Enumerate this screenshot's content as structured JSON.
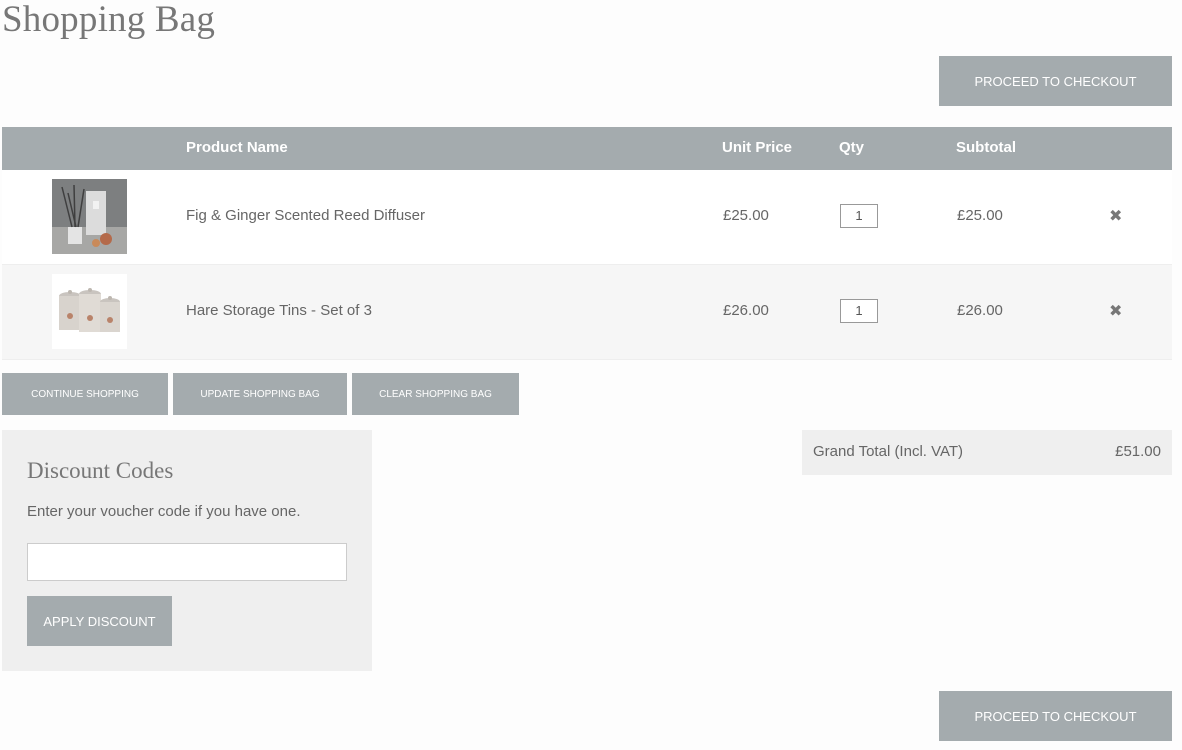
{
  "page": {
    "title": "Shopping Bag"
  },
  "checkout": {
    "label": "Proceed to Checkout"
  },
  "table": {
    "headers": {
      "product_name": "Product Name",
      "unit_price": "Unit Price",
      "qty": "Qty",
      "subtotal": "Subtotal"
    },
    "rows": [
      {
        "name": "Fig & Ginger Scented Reed Diffuser",
        "unit_price": "£25.00",
        "qty": "1",
        "subtotal": "£25.00",
        "thumb_icon": "reed-diffuser-image",
        "remove_icon": "close-icon"
      },
      {
        "name": "Hare Storage Tins - Set of 3",
        "unit_price": "£26.00",
        "qty": "1",
        "subtotal": "£26.00",
        "thumb_icon": "storage-tins-image",
        "remove_icon": "close-icon"
      }
    ]
  },
  "actions": {
    "continue": "Continue Shopping",
    "update": "Update Shopping Bag",
    "clear": "Clear Shopping Bag"
  },
  "discount": {
    "title": "Discount Codes",
    "description": "Enter your voucher code if you have one.",
    "input_value": "",
    "apply_label": "Apply Discount"
  },
  "totals": {
    "label": "Grand Total (Incl. VAT)",
    "value": "£51.00"
  },
  "colors": {
    "button_bg": "#a4abae",
    "panel_bg": "#efefef",
    "text": "#666666"
  }
}
